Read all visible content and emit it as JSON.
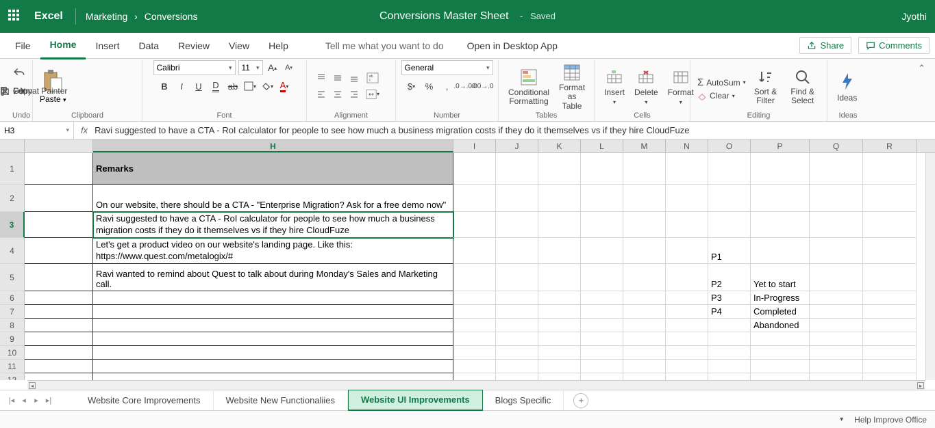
{
  "titlebar": {
    "app": "Excel",
    "breadcrumb1": "Marketing",
    "breadcrumb2": "Conversions",
    "docTitle": "Conversions Master Sheet",
    "savedLabel": "-   Saved",
    "user": "Jyothi"
  },
  "tabs": {
    "file": "File",
    "home": "Home",
    "insert": "Insert",
    "data": "Data",
    "review": "Review",
    "view": "View",
    "help": "Help",
    "search": "Tell me what you want to do",
    "openDesktop": "Open in Desktop App",
    "share": "Share",
    "comments": "Comments"
  },
  "ribbon": {
    "undo": "Undo",
    "clipboard": {
      "paste": "Paste",
      "cut": "Cut",
      "copy": "Copy",
      "painter": "Format Painter",
      "label": "Clipboard"
    },
    "font": {
      "name": "Calibri",
      "size": "11",
      "label": "Font"
    },
    "alignment": {
      "label": "Alignment"
    },
    "number": {
      "general": "General",
      "label": "Number"
    },
    "tables": {
      "cond": "Conditional Formatting",
      "fmt": "Format as Table",
      "label": "Tables"
    },
    "cells": {
      "insert": "Insert",
      "delete": "Delete",
      "format": "Format",
      "label": "Cells"
    },
    "editing": {
      "autosum": "AutoSum",
      "clear": "Clear",
      "sort": "Sort & Filter",
      "find": "Find & Select",
      "label": "Editing"
    },
    "ideas": {
      "btn": "Ideas",
      "label": "Ideas"
    }
  },
  "formulaBar": {
    "cellRef": "H3",
    "fx": "fx",
    "text": "Ravi suggested to have a CTA - RoI calculator for people to see how much a business migration costs if they do it themselves vs if they hire CloudFuze"
  },
  "columns": [
    "H",
    "I",
    "J",
    "K",
    "L",
    "M",
    "N",
    "O",
    "P",
    "Q",
    "R"
  ],
  "cells": {
    "r1h": "Remarks",
    "r2h": "On our website, there should be a CTA - \"Enterprise Migration? Ask for a free demo now\"",
    "r3h": "Ravi suggested to have a CTA - RoI calculator for people to see how much a business migration costs if they do it themselves vs if they hire CloudFuze",
    "r4h": "Let's get a product video on our website's landing page. Like this: https://www.quest.com/metalogix/#",
    "r5h": "Ravi wanted to remind about Quest to talk about during Monday's Sales and Marketing call.",
    "r4o": "P1",
    "r5o": "P2",
    "r5p": "Yet to start",
    "r6o": "P3",
    "r6p": "In-Progress",
    "r7o": "P4",
    "r7p": "Completed",
    "r8p": "Abandoned"
  },
  "sheetTabs": {
    "t1": "Website Core Improvements",
    "t2": "Website New Functionaliies",
    "t3": "Website UI Improvements",
    "t4": "Blogs Specific"
  },
  "status": {
    "help": "Help Improve Office"
  }
}
